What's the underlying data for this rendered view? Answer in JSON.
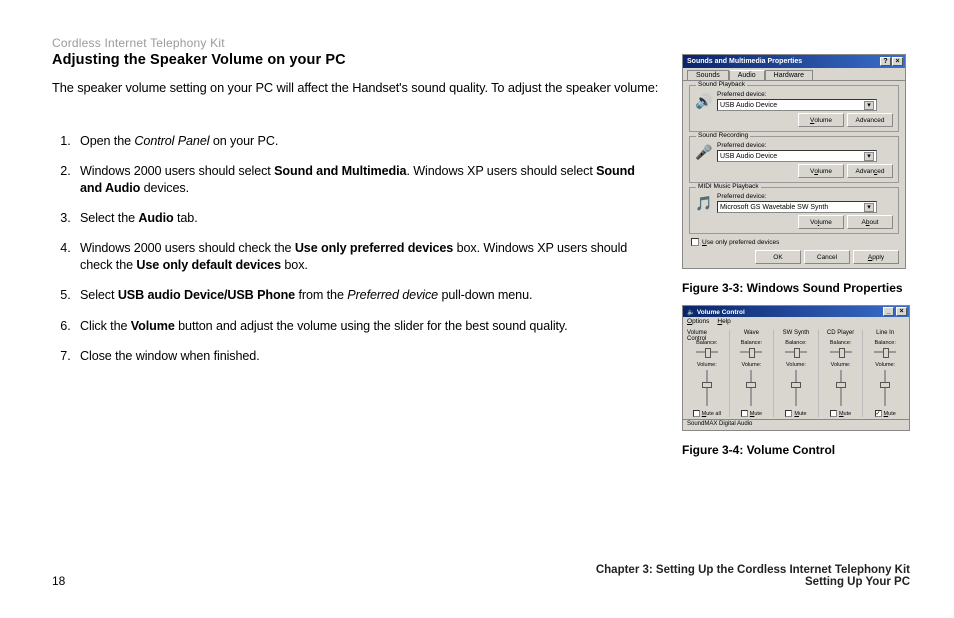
{
  "header_sub": "Cordless Internet Telephony Kit",
  "title": "Adjusting the Speaker Volume on your PC",
  "intro": "The speaker volume setting on your PC will affect the Handset's sound quality. To adjust the speaker volume:",
  "steps": {
    "s1a": "Open the ",
    "s1i": "Control Panel",
    "s1b": " on your PC.",
    "s2a": "Windows 2000 users should select ",
    "s2b1": "Sound and Multimedia",
    "s2c": ". Windows XP users should select ",
    "s2b2": "Sound and Audio",
    "s2d": " devices.",
    "s3a": "Select the ",
    "s3b": "Audio",
    "s3c": " tab.",
    "s4a": "Windows 2000 users should check the ",
    "s4b1": "Use only preferred devices",
    "s4c": " box. Windows XP users should check the ",
    "s4b2": "Use only default devices",
    "s4d": " box.",
    "s5a": "Select ",
    "s5b": "USB audio Device/USB Phone",
    "s5c": " from the ",
    "s5i": "Preferred device",
    "s5d": " pull-down menu.",
    "s6a": "Click the ",
    "s6b": "Volume",
    "s6c": " button and adjust the volume using the slider for the best sound quality.",
    "s7": "Close the window when finished."
  },
  "fig1": {
    "win_title": "Sounds and Multimedia Properties",
    "tab_sounds": "Sounds",
    "tab_audio": "Audio",
    "tab_hardware": "Hardware",
    "grp_playback": "Sound Playback",
    "grp_recording": "Sound Recording",
    "grp_midi": "MIDI Music Playback",
    "lbl_pref": "Preferred device:",
    "dd_playback": "USB Audio Device",
    "dd_recording": "USB Audio Device",
    "dd_midi": "Microsoft GS Wavetable SW Synth",
    "btn_volume": "Volume",
    "btn_advanced": "Advanced",
    "btn_about": "About",
    "chk_useonly": "Use only preferred devices",
    "btn_ok": "OK",
    "btn_cancel": "Cancel",
    "btn_apply": "Apply",
    "caption": "Figure 3-3: Windows Sound Properties"
  },
  "fig2": {
    "win_title": "Volume Control",
    "menu_options": "Options",
    "menu_help": "Help",
    "cols": [
      "Volume Control",
      "Wave",
      "SW Synth",
      "CD Player",
      "Line In"
    ],
    "balance": "Balance:",
    "volume": "Volume:",
    "mute_all": "Mute all",
    "mute": "Mute",
    "status": "SoundMAX Digital Audio",
    "caption": "Figure 3-4: Volume Control"
  },
  "footer": {
    "page_num": "18",
    "chapter": "Chapter 3: Setting Up the Cordless Internet Telephony Kit",
    "section": "Setting Up Your PC"
  }
}
